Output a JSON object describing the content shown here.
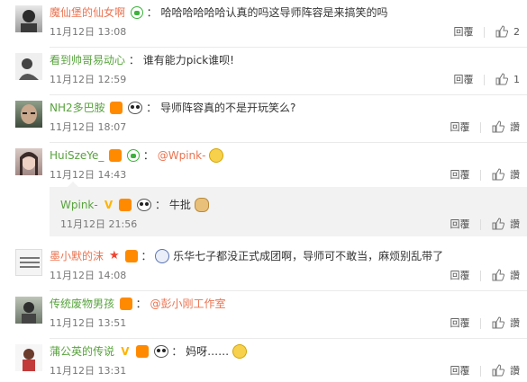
{
  "labels": {
    "reply": "回覆",
    "like_count": "讚"
  },
  "comments": [
    {
      "user": "魔仙堡的仙女啊",
      "text": "哈哈哈哈哈哈认真的吗这导师阵容是来搞笑的吗",
      "time": "11月12日 13:08",
      "likes": "2"
    },
    {
      "user": "看到帅哥易动心",
      "text": "谁有能力pick谁呗!",
      "time": "11月12日 12:59",
      "likes": "1"
    },
    {
      "user": "NH2多巴胺",
      "text": "导师阵容真的不是开玩笑么?",
      "time": "11月12日 18:07",
      "likes": ""
    },
    {
      "user": "HuiSzeYe_",
      "mention": "@Wpink-",
      "time": "11月12日 14:43",
      "likes": "",
      "reply": {
        "user": "Wpink-",
        "text": "牛批",
        "time": "11月12日 21:56",
        "likes": ""
      }
    },
    {
      "user": "墨小默的沫",
      "text": "乐华七子都没正式成团啊，导师可不敢当，麻烦别乱带了",
      "time": "11月12日 14:08",
      "likes": ""
    },
    {
      "user": "传统废物男孩",
      "mention": "@彭小刚工作室",
      "time": "11月12日 13:51",
      "likes": ""
    },
    {
      "user": "蒲公英的传说",
      "text": "妈呀……",
      "time": "11月12日 13:31",
      "likes": ""
    }
  ],
  "icons": {
    "badge_vip": "vip-badge-icon",
    "badge_fan": "fan-heart-icon",
    "badge_panda": "panda-icon",
    "badge_v": "verified-v-icon",
    "like": "thumbs-up-icon"
  },
  "colors": {
    "username": "#eb7350",
    "username_green": "#58a33d",
    "meta": "#777777"
  }
}
